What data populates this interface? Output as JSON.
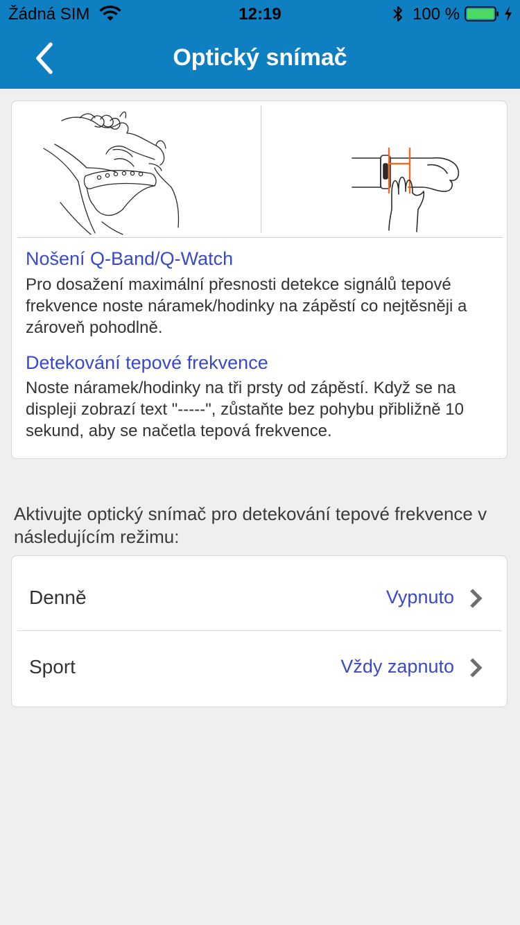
{
  "status_bar": {
    "carrier": "Žádná SIM",
    "time": "12:19",
    "battery_percent": "100 %"
  },
  "nav": {
    "title": "Optický snímač"
  },
  "info": {
    "sections": [
      {
        "heading": "Nošení Q-Band/Q-Watch",
        "text": "Pro dosažení maximální přesnosti detekce signálů tepové frekvence noste náramek/hodinky na zápěstí co nejtěsněji a zároveň pohodlně."
      },
      {
        "heading": "Detekování tepové frekvence",
        "text": "Noste náramek/hodinky na tři prsty od zápěstí. Když se na displeji zobrazí text \"-----\", zůstaňte bez pohybu přibližně 10 sekund, aby se načetla tepová frekvence."
      }
    ]
  },
  "mode_prompt": "Aktivujte optický snímač pro detekování tepové frekvence v následujícím režimu:",
  "modes": [
    {
      "label": "Denně",
      "value": "Vypnuto"
    },
    {
      "label": "Sport",
      "value": "Vždy zapnuto"
    }
  ],
  "colors": {
    "nav_bar": "#0e7fc0",
    "accent_text": "#3a49c7",
    "background": "#efeff0",
    "battery_fill": "#4cd964",
    "illustration_marker": "#f06a23"
  },
  "icons": {
    "back": "chevron-left-icon",
    "row_arrow": "chevron-right-icon",
    "wifi": "wifi-icon",
    "bluetooth": "bluetooth-icon",
    "battery": "battery-icon",
    "charging": "charging-bolt-icon"
  }
}
